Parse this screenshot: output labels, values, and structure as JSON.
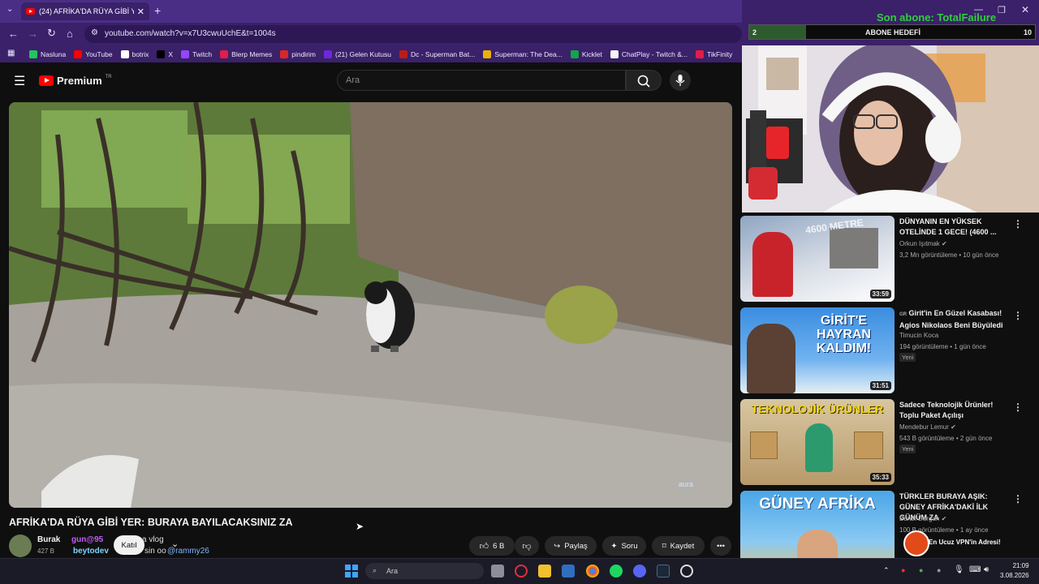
{
  "browser": {
    "tab_title": "(24) AFRİKA'DA RÜYA GİBİ YER: BU",
    "url": "youtube.com/watch?v=x7U3cwuUchE&t=1004s",
    "bookmarks": [
      {
        "label": "Nasluna",
        "color": "#22c55e"
      },
      {
        "label": "YouTube",
        "color": "#ff0000"
      },
      {
        "label": "botrix",
        "color": "#ffffff"
      },
      {
        "label": "X",
        "color": "#000000"
      },
      {
        "label": "Twitch",
        "color": "#9146ff"
      },
      {
        "label": "Blerp Memes",
        "color": "#e11d48"
      },
      {
        "label": "pindirim",
        "color": "#dc2626"
      },
      {
        "label": "(21) Gelen Kutusu",
        "color": "#6d28d9"
      },
      {
        "label": "Dc - Superman Bat...",
        "color": "#b91c1c"
      },
      {
        "label": "Superman: The Dea...",
        "color": "#eab308"
      },
      {
        "label": "Kicklet",
        "color": "#16a34a"
      },
      {
        "label": "ChatPlay - Twitch &...",
        "color": "#f5f5f5"
      },
      {
        "label": "TikFinity",
        "color": "#e11d48"
      }
    ]
  },
  "overlay": {
    "sub_text": "Son abone: TotalFailure",
    "goal_current": "2",
    "goal_label": "ABONE HEDEFİ",
    "goal_target": "10",
    "goal_fraction": 0.2
  },
  "youtube": {
    "logo": "Premium",
    "logo_badge": "TR",
    "search_placeholder": "Ara",
    "video": {
      "title": "AFRİKA'DA RÜYA GİBİ YER: BURAYA BAYILACAKSINIZ ZA",
      "channel": "Burak",
      "subs": "427 B",
      "join": "Katıl",
      "likes": "6 B",
      "share": "Paylaş",
      "ask": "Soru",
      "save": "Kaydet",
      "watermark": "aura"
    },
    "chat_overlay": [
      "gun@95",
      "a vlog",
      "beytodev",
      "sin oo",
      "@rammy26"
    ],
    "recommendations": [
      {
        "title": "DÜNYANIN EN YÜKSEK OTELİNDE 1 GECE! (4600 ...",
        "channel": "Orkun Işıtmak",
        "meta": "3,2 Mn görüntüleme • 10 gün önce",
        "duration": "33:59",
        "thumb_text": "4600 METRE",
        "is_new": false
      },
      {
        "title": "Girit'in En Güzel Kasabası! Agios Nikolaos Beni Büyüledi",
        "prefix": "GR",
        "channel": "Timucin Koca",
        "meta": "194 görüntüleme • 1 gün önce",
        "duration": "31:51",
        "thumb_text": "GİRİT'E HAYRAN KALDIM!",
        "is_new": true
      },
      {
        "title": "Sadece Teknolojik Ürünler! Toplu Paket Açılışı",
        "channel": "Mendebur Lemur",
        "meta": "543 B görüntüleme • 2 gün önce",
        "duration": "35:33",
        "thumb_text": "TEKNOLOJİK ÜRÜNLER",
        "is_new": true
      },
      {
        "title": "TÜRKLER BURAYA AŞIK: GÜNEY AFRİKA'DAKİ İLK GÜNÜM ZA",
        "channel": "Burak Durgun",
        "meta": "100 B görüntüleme • 1 ay önce",
        "duration": "",
        "thumb_text": "GÜNEY AFRİKA",
        "is_new": false
      }
    ],
    "promo": "En Ucuz VPN'in Adresi!",
    "new_label": "Yeni"
  },
  "taskbar": {
    "search": "Ara",
    "time": "21:09",
    "date": "3.08.2026"
  }
}
